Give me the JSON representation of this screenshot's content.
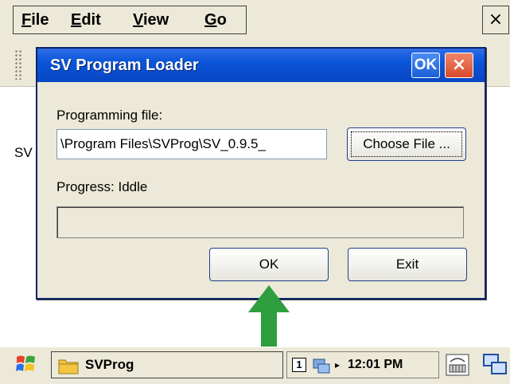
{
  "menubar": {
    "items": [
      {
        "label": "File",
        "mnemonic": "F",
        "rest": "ile"
      },
      {
        "label": "Edit",
        "mnemonic": "E",
        "rest": "dit"
      },
      {
        "label": "View",
        "mnemonic": "V",
        "rest": "iew"
      },
      {
        "label": "Go",
        "mnemonic": "G",
        "rest": "o"
      }
    ],
    "close_glyph": "×"
  },
  "background_text": "SV",
  "dialog": {
    "title": "SV Program Loader",
    "ok_title_label": "OK",
    "close_glyph": "×",
    "file_label": "Programming file:",
    "file_value": "\\Program Files\\SVProg\\SV_0.9.5_",
    "choose_label": "Choose File ...",
    "progress_text": "Progress: Iddle",
    "progress_fraction": 0,
    "ok_label": "OK",
    "exit_label": "Exit"
  },
  "taskbar": {
    "task_label": "SVProg",
    "tray_input": "1",
    "play_glyph": "▸",
    "clock": "12:01 PM"
  },
  "colors": {
    "title_blue": "#0a55d8",
    "arrow_green": "#2e9e3e",
    "close_red": "#d84a2a"
  }
}
